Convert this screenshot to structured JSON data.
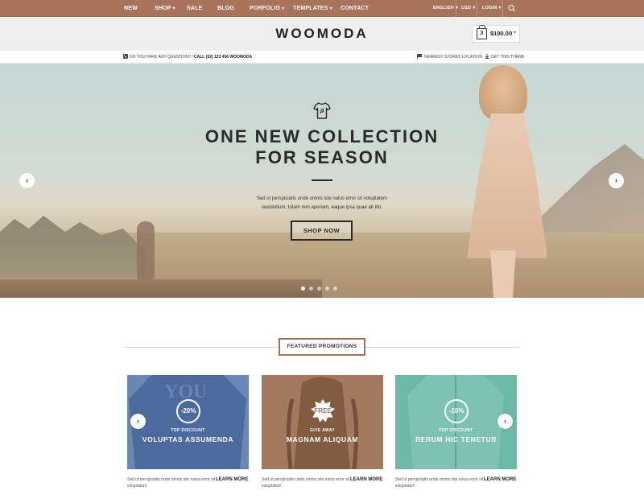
{
  "nav": {
    "items": [
      {
        "label": "NEW",
        "caret": false
      },
      {
        "label": "SHOP",
        "caret": true
      },
      {
        "label": "SALE",
        "caret": false
      },
      {
        "label": "BLOG",
        "caret": false
      },
      {
        "label": "PORFOLIO",
        "caret": true
      },
      {
        "label": "TEMPLATES",
        "caret": true
      },
      {
        "label": "CONTACT",
        "caret": false
      }
    ],
    "language": "ENGLISH",
    "currency": "USD",
    "login": "LOGIN",
    "caret_glyph": "▾",
    "search_icon": "search-icon"
  },
  "header": {
    "logo": "WOOMODA",
    "cart_count": "3",
    "cart_total": "$100.00"
  },
  "infobar": {
    "question": "DO YOU HAVE ANY QUESTION?",
    "call": "CALL (02) 123 456 WOOMODA",
    "stores": "NEAREST STORES LOCATION",
    "get_theme": "GET THIS THEME"
  },
  "hero": {
    "title_line1": "ONE NEW COLLECTION",
    "title_line2": "FOR SEASON",
    "text_line1": "Sed ut perspiciatis unde omnis iste natus error sit voluptatem",
    "text_line2": "laudantium, totam rem aperiam, eaque ipsa quae ab illo.",
    "button": "SHOP NOW",
    "prev": "‹",
    "next": "›",
    "slide_count": 5,
    "active_slide": 0
  },
  "featured": {
    "title": "FEATURED PROMOTIONS",
    "prev": "‹",
    "next": "›",
    "cards": [
      {
        "badge": "-20%",
        "subtitle": "TOP DISCOUNT",
        "name": "VOLUPTAS ASSUMENDA",
        "desc": "Sed ut perspiciatis unde omnis iste natus error sit voluptatem",
        "link": "LEARN MORE",
        "color": "#6a87b4"
      },
      {
        "badge": "FREE",
        "subtitle": "GIVE AWAY",
        "name": "MAGNAM ALIQUAM",
        "desc": "Sed ut perspiciatis unde omnis iste natus error sit voluptatem",
        "link": "LEARN MORE",
        "color": "#a3785e"
      },
      {
        "badge": "-10%",
        "subtitle": "TOP DISCOUNT",
        "name": "RERUM HIC TENETUR",
        "desc": "Sed ut perspiciatis unde omnis iste natus error sit voluptatem",
        "link": "LEARN MORE",
        "color": "#6bbaa8"
      }
    ]
  },
  "colors": {
    "brand": "#a9725a",
    "header_bg": "#efefef"
  }
}
